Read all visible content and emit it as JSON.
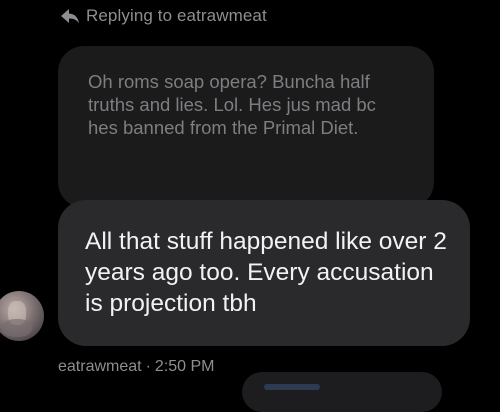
{
  "reply_header": {
    "icon": "reply-arrow-icon",
    "text": "Replying to eatrawmeat"
  },
  "quoted_message": {
    "text": "Oh roms soap opera? Buncha half truths and lies. Lol. Hes jus mad bc hes banned from the Primal Diet."
  },
  "reply_message": {
    "text": "All that stuff happened like over 2 years ago too. Every accusation is projection tbh"
  },
  "meta": {
    "username": "eatrawmeat",
    "separator": "·",
    "time": "2:50 PM"
  },
  "colors": {
    "background": "#000000",
    "quoted_bubble": "#1b1b1c",
    "reply_bubble": "#2a2a2c",
    "muted_text": "#8c8e92",
    "primary_text": "#f2f2f2"
  }
}
